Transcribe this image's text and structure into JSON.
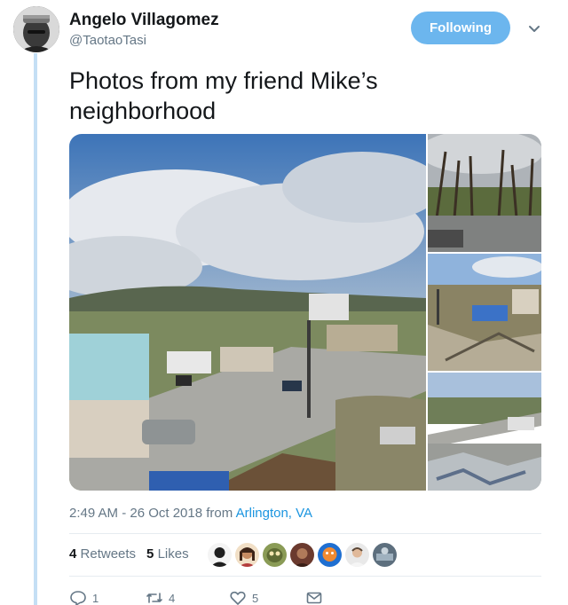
{
  "author": {
    "name": "Angelo Villagomez",
    "handle": "@TaotaoTasi"
  },
  "follow_button": {
    "label": "Following"
  },
  "tweet": {
    "text": "Photos from my friend Mike’s neighborhood"
  },
  "meta": {
    "timestamp": "2:49 AM - 26 Oct 2018",
    "from_label": " from ",
    "location": "Arlington, VA"
  },
  "stats": {
    "retweets_count": "4",
    "retweets_label": "Retweets",
    "likes_count": "5",
    "likes_label": "Likes"
  },
  "actions": {
    "reply_count": "1",
    "retweet_count": "4",
    "like_count": "5"
  },
  "colors": {
    "accent": "#1b95e0",
    "follow_button": "#6cb6ee",
    "thread_line": "#c4dff5"
  }
}
